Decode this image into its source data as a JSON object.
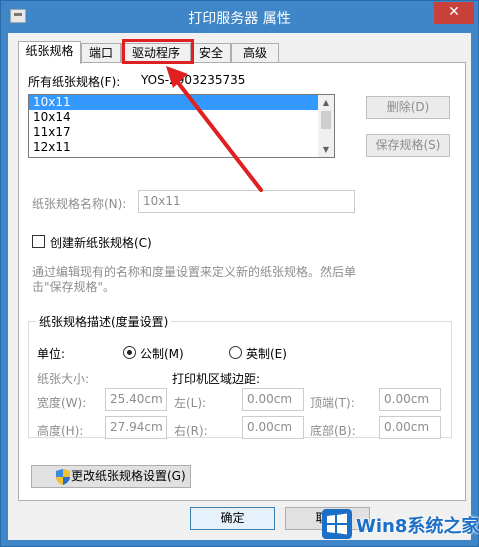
{
  "window": {
    "title": "打印服务器 属性",
    "close_glyph": "✕"
  },
  "tabs": [
    {
      "label": "纸张规格"
    },
    {
      "label": "端口"
    },
    {
      "label": "驱动程序"
    },
    {
      "label": "安全"
    },
    {
      "label": "高级"
    }
  ],
  "forms": {
    "all_forms_label": "所有纸张规格(F):",
    "server_name": "YOS-2903235735",
    "list_items": [
      "10x11",
      "10x14",
      "11x17",
      "12x11"
    ],
    "delete_button": "删除(D)",
    "save_button": "保存规格(S)",
    "form_name_label": "纸张规格名称(N):",
    "form_name_value": "10x11",
    "create_new_label": "创建新纸张规格(C)",
    "hint_text_1": "通过编辑现有的名称和度量设置来定义新的纸张规格。然后单",
    "hint_text_2": "击\"保存规格\"。",
    "group_title": "纸张规格描述(度量设置)",
    "units_label": "单位:",
    "metric_label": "公制(M)",
    "english_label": "英制(E)",
    "paper_size_label": "纸张大小:",
    "margins_label": "打印机区域边距:",
    "width_label": "宽度(W):",
    "width_value": "25.40cm",
    "height_label": "高度(H):",
    "height_value": "27.94cm",
    "left_label": "左(L):",
    "left_value": "0.00cm",
    "right_label": "右(R):",
    "right_value": "0.00cm",
    "top_label": "顶端(T):",
    "top_value": "0.00cm",
    "bottom_label": "底部(B):",
    "bottom_value": "0.00cm",
    "change_settings_button": "更改纸张规格设置(G)"
  },
  "footer": {
    "ok_button": "确定",
    "cancel_button": "取消"
  },
  "watermark": {
    "text": "Win8系统之家"
  },
  "colors": {
    "title_bar": "#3e86c8",
    "highlight": "#e02020",
    "selection": "#3399ff"
  }
}
